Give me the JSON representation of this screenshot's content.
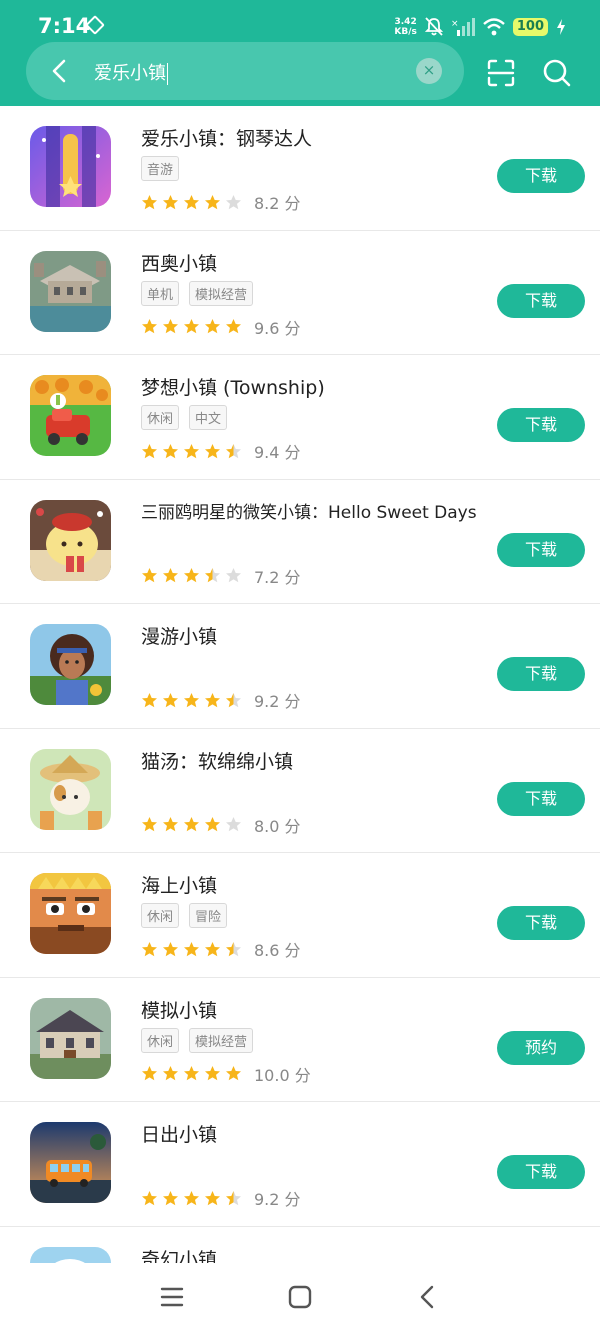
{
  "status_bar": {
    "time": "7:14",
    "net_speed_value": "3.42",
    "net_speed_unit": "KB/s",
    "battery": "100"
  },
  "search": {
    "query": "爱乐小镇",
    "back_icon": "back-arrow-icon",
    "clear_icon": "clear-icon",
    "clear_glyph": "×",
    "scan_icon": "scan-icon",
    "search_icon": "search-icon"
  },
  "colors": {
    "brand": "#1fb899",
    "star": "#f7b51a",
    "star_empty": "#dcdcdc"
  },
  "apps": [
    {
      "title": "爱乐小镇：钢琴达人",
      "tags": [
        "音游"
      ],
      "rating": 4,
      "score": "8.2 分",
      "button": "下载"
    },
    {
      "title": "西奥小镇",
      "tags": [
        "单机",
        "模拟经营"
      ],
      "rating": 5,
      "score": "9.6 分",
      "button": "下载"
    },
    {
      "title": "梦想小镇 (Township)",
      "tags": [
        "休闲",
        "中文"
      ],
      "rating": 4.5,
      "score": "9.4 分",
      "button": "下载"
    },
    {
      "title": "三丽鸥明星的微笑小镇：Hello Sweet Days",
      "tags": [],
      "rating": 3.5,
      "score": "7.2 分",
      "button": "下载"
    },
    {
      "title": "漫游小镇",
      "tags": [],
      "rating": 4.5,
      "score": "9.2 分",
      "button": "下载"
    },
    {
      "title": "猫汤：软绵绵小镇",
      "tags": [],
      "rating": 4,
      "score": "8.0 分",
      "button": "下载"
    },
    {
      "title": "海上小镇",
      "tags": [
        "休闲",
        "冒险"
      ],
      "rating": 4.5,
      "score": "8.6 分",
      "button": "下载"
    },
    {
      "title": "模拟小镇",
      "tags": [
        "休闲",
        "模拟经营"
      ],
      "rating": 5,
      "score": "10.0 分",
      "button": "预约"
    },
    {
      "title": "日出小镇",
      "tags": [],
      "rating": 4.5,
      "score": "9.2 分",
      "button": "下载"
    },
    {
      "title": "奇幻小镇",
      "tags": [],
      "rating": null,
      "score": "",
      "button": ""
    }
  ],
  "nav": {
    "menu_icon": "menu-icon",
    "home_icon": "home-icon",
    "back_icon": "nav-back-icon"
  }
}
